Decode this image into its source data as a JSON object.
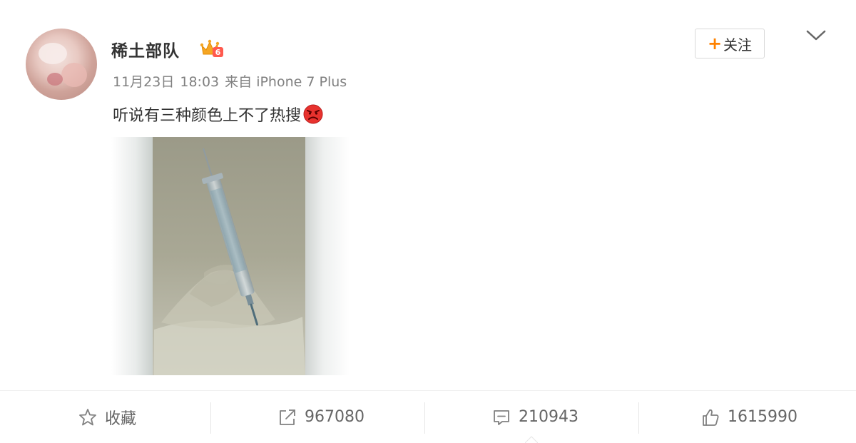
{
  "post": {
    "username": "稀土部队",
    "date": "11月23日",
    "time": "18:03",
    "source_prefix": "来自",
    "source_device": "iPhone 7 Plus",
    "text": "听说有三种颜色上不了热搜",
    "emoji": "angry-face-emoji",
    "image": "syringe-photo"
  },
  "header": {
    "follow_label": "关注",
    "follow_plus": "+"
  },
  "actions": {
    "favorite_label": "收藏",
    "repost_count": "967080",
    "comment_count": "210943",
    "like_count": "1615990"
  },
  "colors": {
    "accent": "#ff8200",
    "text_primary": "#333333",
    "text_secondary": "#808080",
    "action_text": "#666666"
  },
  "icons": {
    "vip": "vip-crown-badge-icon",
    "menu": "chevron-down-icon",
    "favorite": "star-icon",
    "repost": "share-arrow-icon",
    "comment": "comment-bubble-icon",
    "like": "thumbs-up-icon"
  }
}
